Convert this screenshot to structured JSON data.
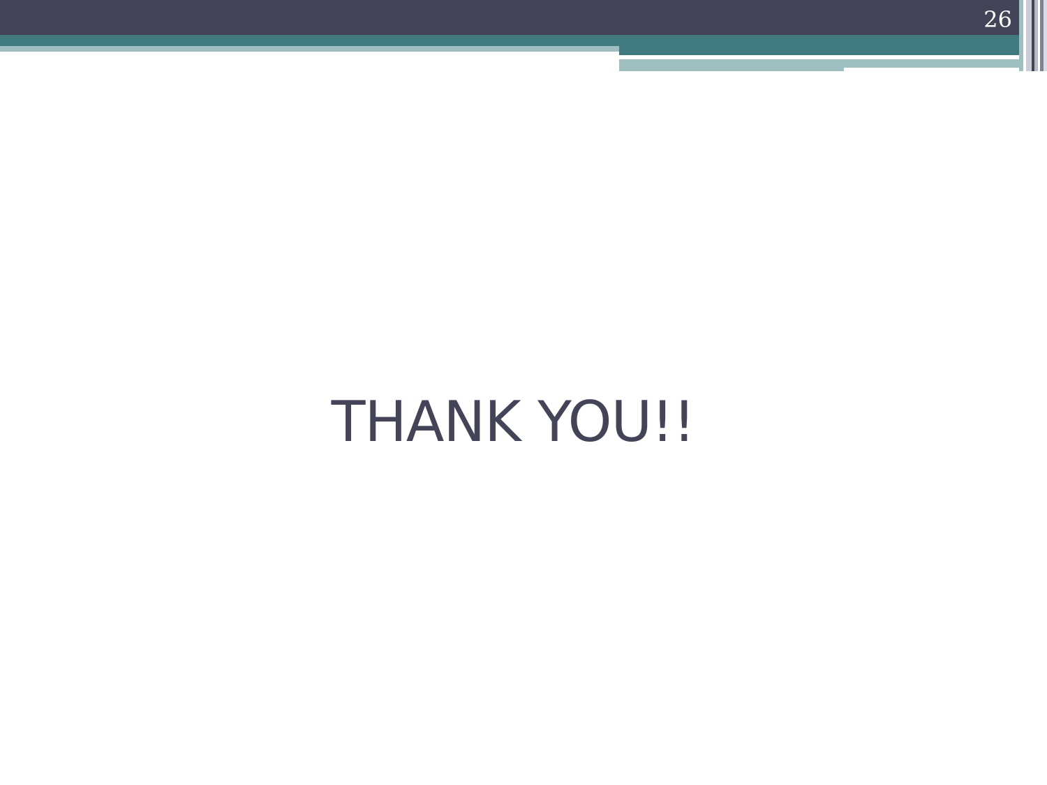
{
  "slide": {
    "page_number": "26",
    "title": "THANK YOU!!"
  },
  "colors": {
    "header": "#434457",
    "teal": "#417b80",
    "light_teal": "#9dbfc0",
    "text": "#434457",
    "background": "#ffffff"
  }
}
